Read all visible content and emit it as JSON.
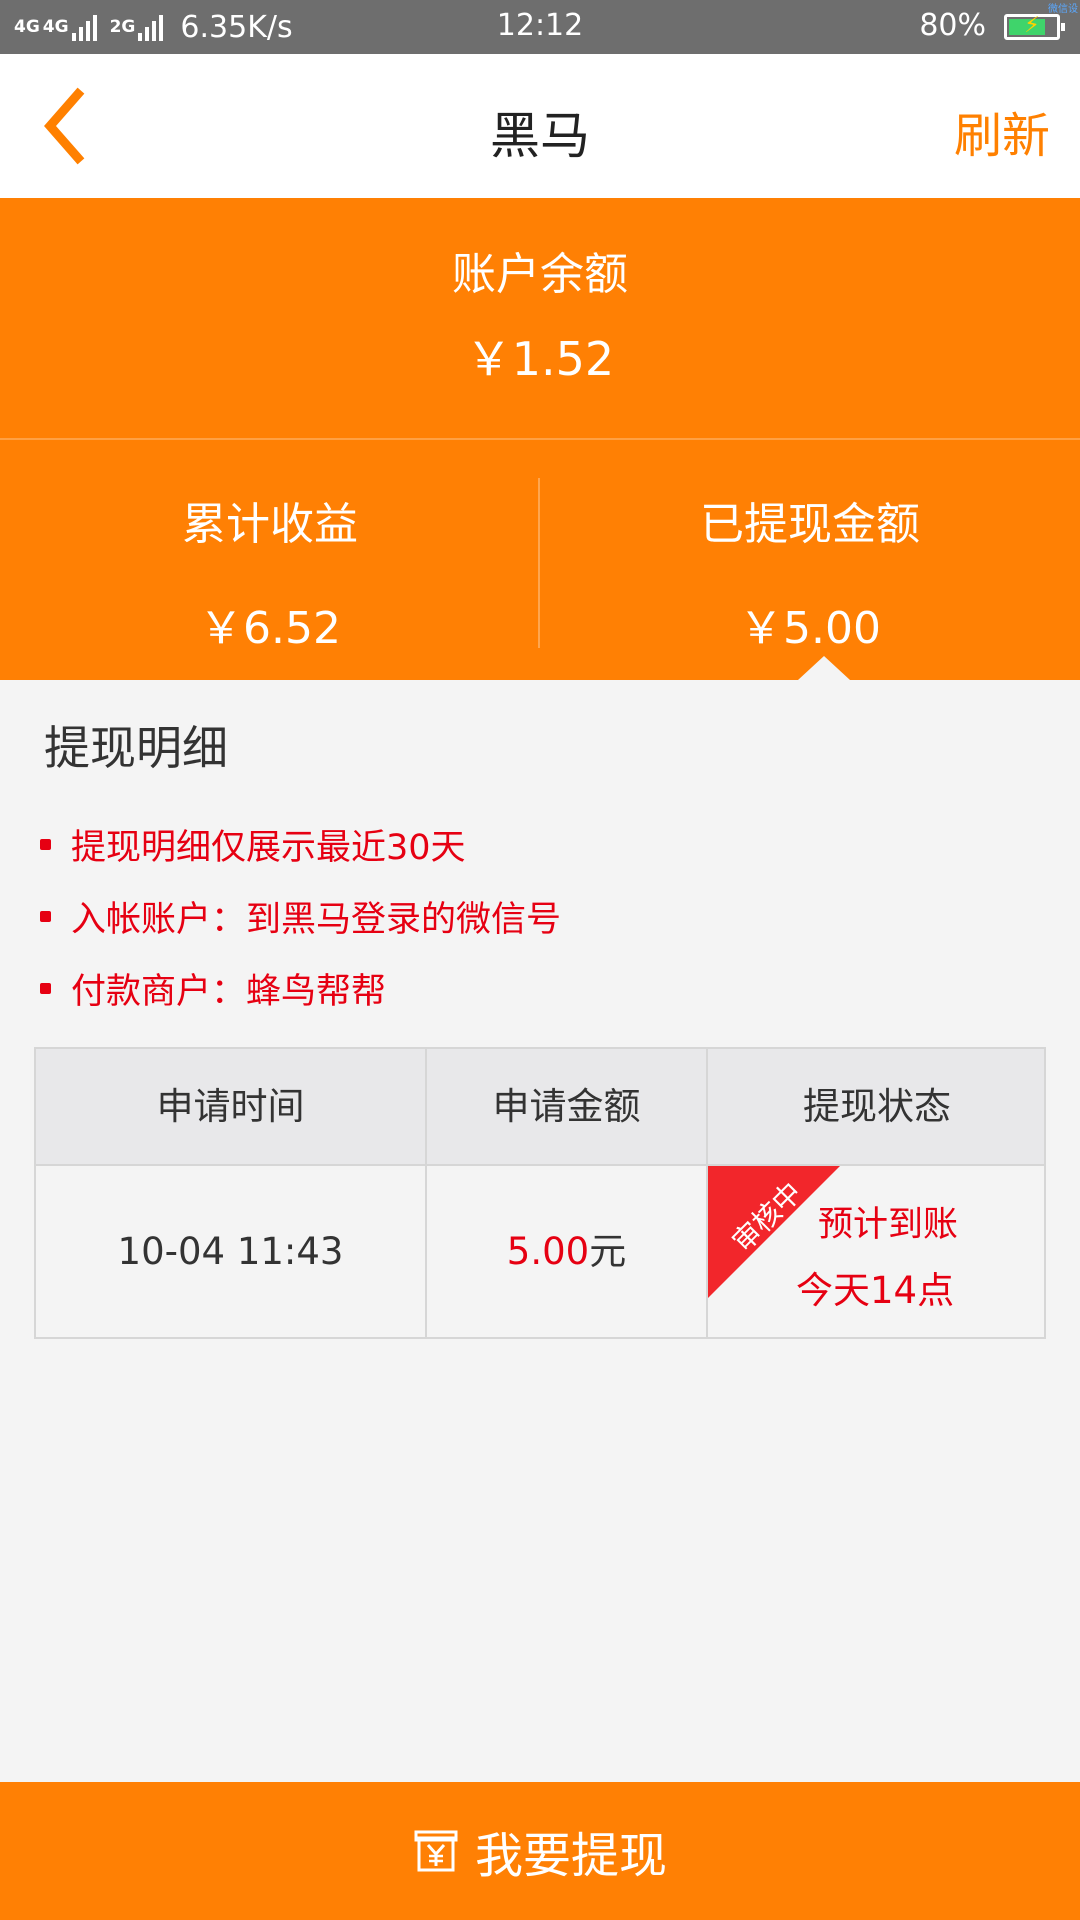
{
  "status_bar": {
    "network_1": "4G",
    "network_2": "4G",
    "network_3": "2G",
    "speed": "6.35K/s",
    "time": "12:12",
    "battery_percent": "80%",
    "battery_level": 0.8,
    "corner_text": "微信设"
  },
  "nav": {
    "title": "黑马",
    "refresh_label": "刷新",
    "accent_color": "#ff8000"
  },
  "summary": {
    "balance_label": "账户余额",
    "balance_value": "￥1.52",
    "total_income_label": "累计收益",
    "total_income_value": "￥6.52",
    "withdrawn_label": "已提现金额",
    "withdrawn_value": "￥5.00",
    "background_color": "#ff8004"
  },
  "details": {
    "title": "提现明细",
    "notes": [
      "提现明细仅展示最近30天",
      "入帐账户：到黑马登录的微信号",
      "付款商户：蜂鸟帮帮"
    ],
    "note_color": "#e60012"
  },
  "table": {
    "headers": [
      "申请时间",
      "申请金额",
      "提现状态"
    ],
    "rows": [
      {
        "time": "10-04 11:43",
        "amount": "5.00",
        "amount_unit": "元",
        "status_badge": "审核中",
        "status_line1": "预计到账",
        "status_line2": "今天14点"
      }
    ]
  },
  "footer": {
    "withdraw_label": "我要提现",
    "icon": "yuan-wallet-icon"
  }
}
